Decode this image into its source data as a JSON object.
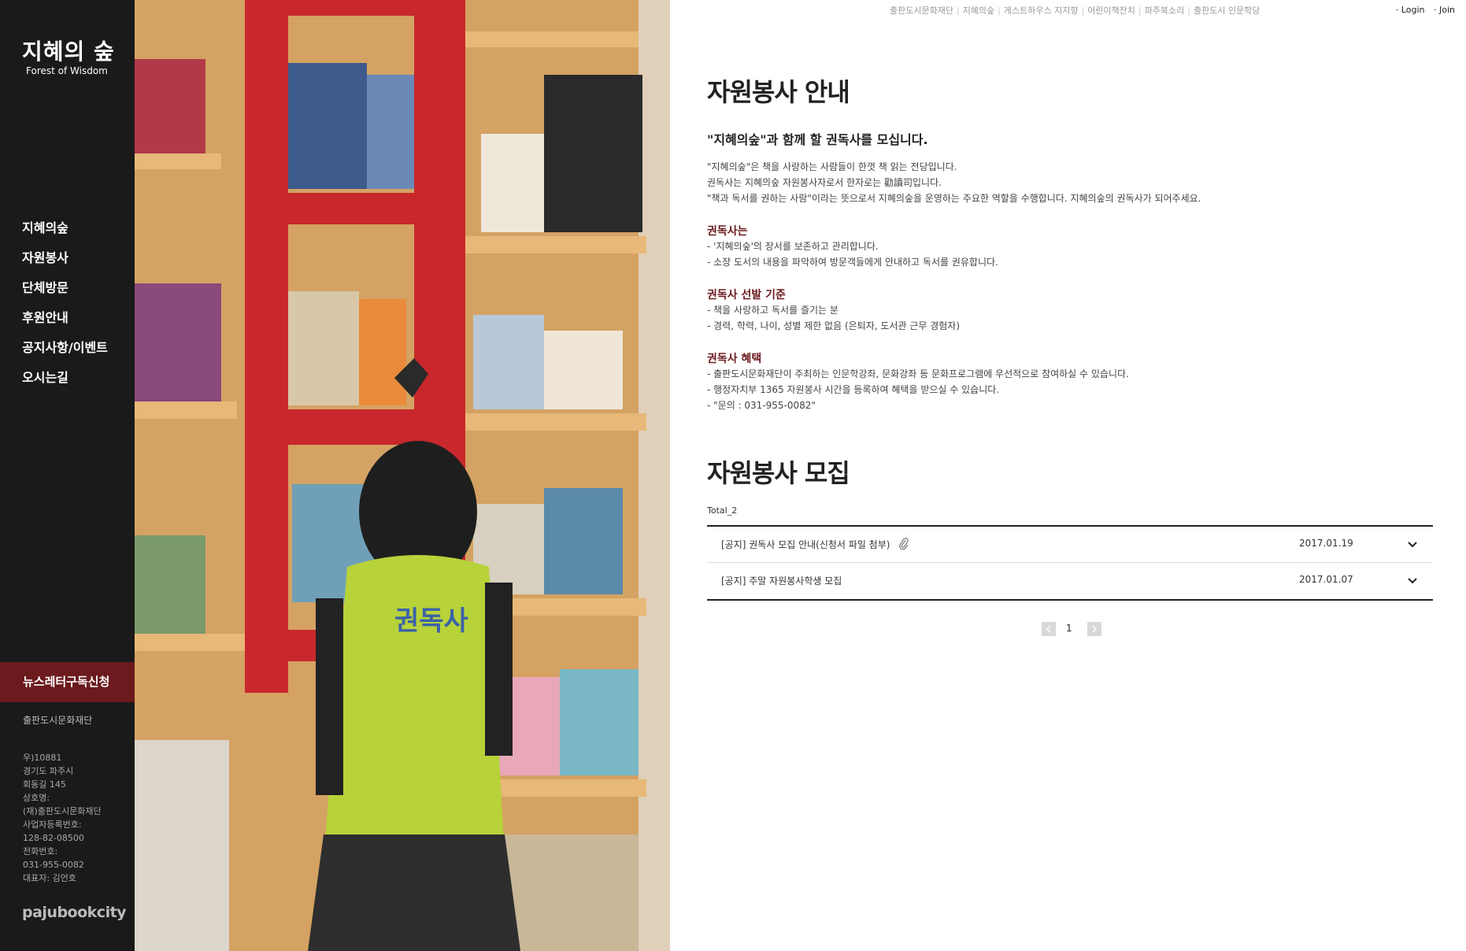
{
  "sidebar": {
    "logo_ko": "지혜의 숲",
    "logo_en": "Forest of Wisdom",
    "nav": [
      "지혜의숲",
      "자원봉사",
      "단체방문",
      "후원안내",
      "공지사항/이벤트",
      "오시는길"
    ],
    "newsletter_label": "뉴스레터구독신청",
    "foundation_label": "출판도시문화재단",
    "address_lines": [
      "우)10881",
      "경기도 파주시",
      "회동길 145",
      "상호명:",
      "(재)출판도시문화재단",
      "사업자등록번호:",
      "128-82-08500",
      "전화번호:",
      "031-955-0082",
      "대표자: 김언호"
    ],
    "brand": "pajubookcity"
  },
  "top_links": [
    "출판도시문화재단",
    "지혜의숲",
    "게스트하우스 지지향",
    "어린이책잔치",
    "파주북소리",
    "출판도시 인문학당"
  ],
  "auth": {
    "login": "Login",
    "join": "Join"
  },
  "content": {
    "title": "자원봉사 안내",
    "lead": "\"지혜의숲\"과 함께 할 권독사를 모십니다.",
    "intro": [
      "\"지혜의숲\"은 책을 사랑하는 사람들이 한껏 책 읽는 전당입니다.",
      "권독사는 지혜의숲 자원봉사자로서 한자로는 勸讀司입니다.",
      "\"책과 독서를 권하는 사람\"이라는 뜻으로서 지혜의숲을 운영하는 주요한 역할을 수행합니다. 지혜의숲의 권독사가 되어주세요."
    ],
    "sections": [
      {
        "heading": "권독사는",
        "lines": [
          "- '지혜의숲'의 장서를 보존하고 관리합니다.",
          "- 소장 도서의 내용을 파악하여 방문객들에게 안내하고 독서를 권유합니다."
        ]
      },
      {
        "heading": "권독사 선발 기준",
        "lines": [
          "- 책을 사랑하고 독서를 즐기는 분",
          "- 경력, 학력, 나이, 성별 제한 없음 (은퇴자, 도서관 근무 경험자)"
        ]
      },
      {
        "heading": "권독사 혜택",
        "lines": [
          "- 출판도시문화재단이 주최하는 인문학강좌, 문화강좌 등 문화프로그램에 우선적으로 참여하실 수 있습니다.",
          "- 행정자치부 1365 자원봉사 시간을 등록하여 혜택을 받으실 수 있습니다.",
          "- \"문의 : 031-955-0082\""
        ]
      }
    ],
    "recruit_title": "자원봉사 모집",
    "total": "Total_2",
    "posts": [
      {
        "title": "[공지] 권독사 모집 안내(신청서 파일 첨부)",
        "date": "2017.01.19",
        "attachment": true
      },
      {
        "title": "[공지] 주말 자원봉사학생 모집",
        "date": "2017.01.07",
        "attachment": false
      }
    ],
    "page": "1"
  },
  "colors": {
    "sidebar_bg": "#1a1a1a",
    "accent": "#6b1a1d",
    "shelf_wood": "#d6a464",
    "shelf_red": "#c8282c"
  },
  "icons": {
    "prev": "chevron-left-icon",
    "next": "chevron-right-icon",
    "toggle": "chevron-down-icon",
    "attachment": "paperclip-icon"
  }
}
